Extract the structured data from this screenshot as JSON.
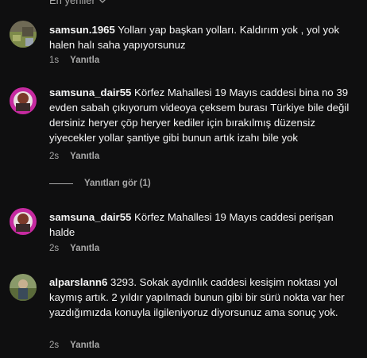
{
  "sort": {
    "label": "En yeniler"
  },
  "comments": [
    {
      "username": "samsun.1965",
      "text": "Yolları yap başkan yolları. Kaldırım yok , yol yok halen halı saha yapıyorsunuz",
      "time": "1s",
      "reply_label": "Yanıtla"
    },
    {
      "username": "samsuna_dair55",
      "text": "Körfez Mahallesi 19 Mayıs caddesi bina no 39 evden sabah çıkıyorum videoya çeksem burası Türkiye bile değil dersiniz heryer çöp heryer kediler için bırakılmış düzensiz yiyecekler yollar şantiye gibi bunun artık izahı bile yok",
      "time": "2s",
      "reply_label": "Yanıtla"
    },
    {
      "username": "samsuna_dair55",
      "text": "Körfez Mahallesi 19 Mayıs caddesi perişan halde",
      "time": "2s",
      "reply_label": "Yanıtla"
    },
    {
      "username": "alparslann6",
      "text": "3293. Sokak aydınlık caddesi kesişim noktası yol kaymış artık. 2 yıldır yapılmadı bunun gibi bir sürü nokta var her yazdığımızda konuyla ilgileniyoruz diyorsunuz ama sonuç yok.",
      "time": "2s",
      "reply_label": "Yanıtla"
    }
  ],
  "view_replies": {
    "label": "Yanıtları gör (1)"
  },
  "colors": {
    "background": "#0f0f10",
    "text": "#f5f5f5",
    "muted": "#a8a8a8"
  }
}
